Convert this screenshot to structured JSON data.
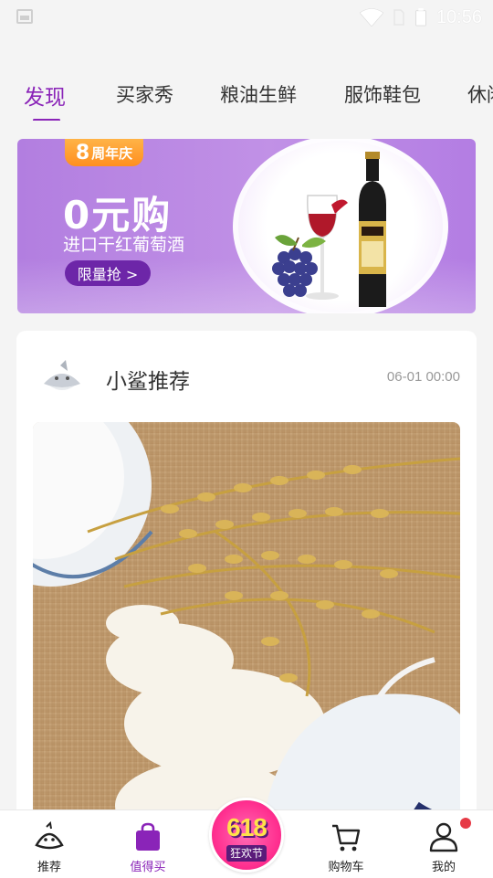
{
  "status_bar": {
    "time": "10:56"
  },
  "tabs": [
    {
      "label": "发现",
      "active": true
    },
    {
      "label": "买家秀",
      "active": false
    },
    {
      "label": "粮油生鲜",
      "active": false
    },
    {
      "label": "服饰鞋包",
      "active": false
    },
    {
      "label": "休闲",
      "active": false
    }
  ],
  "banner": {
    "anniv_number": "8",
    "anniv_text": "周年庆",
    "title": "0元购",
    "subtitle": "进口干红葡萄酒",
    "button": "限量抢 >"
  },
  "post": {
    "author": "小鲨推荐",
    "time": "06-01 00:00"
  },
  "bottom_nav": [
    {
      "label": "推荐",
      "icon": "shark-icon",
      "active": false
    },
    {
      "label": "值得买",
      "icon": "shopping-bag-icon",
      "active": true
    },
    {
      "label": "618",
      "sub": "狂欢节",
      "icon": "promo-618-icon"
    },
    {
      "label": "购物车",
      "icon": "cart-icon",
      "active": false
    },
    {
      "label": "我的",
      "icon": "user-icon",
      "active": false,
      "badge": true
    }
  ],
  "colors": {
    "accent": "#8a24b8",
    "badge": "#e63a46",
    "promo": "#ff2f8f"
  }
}
